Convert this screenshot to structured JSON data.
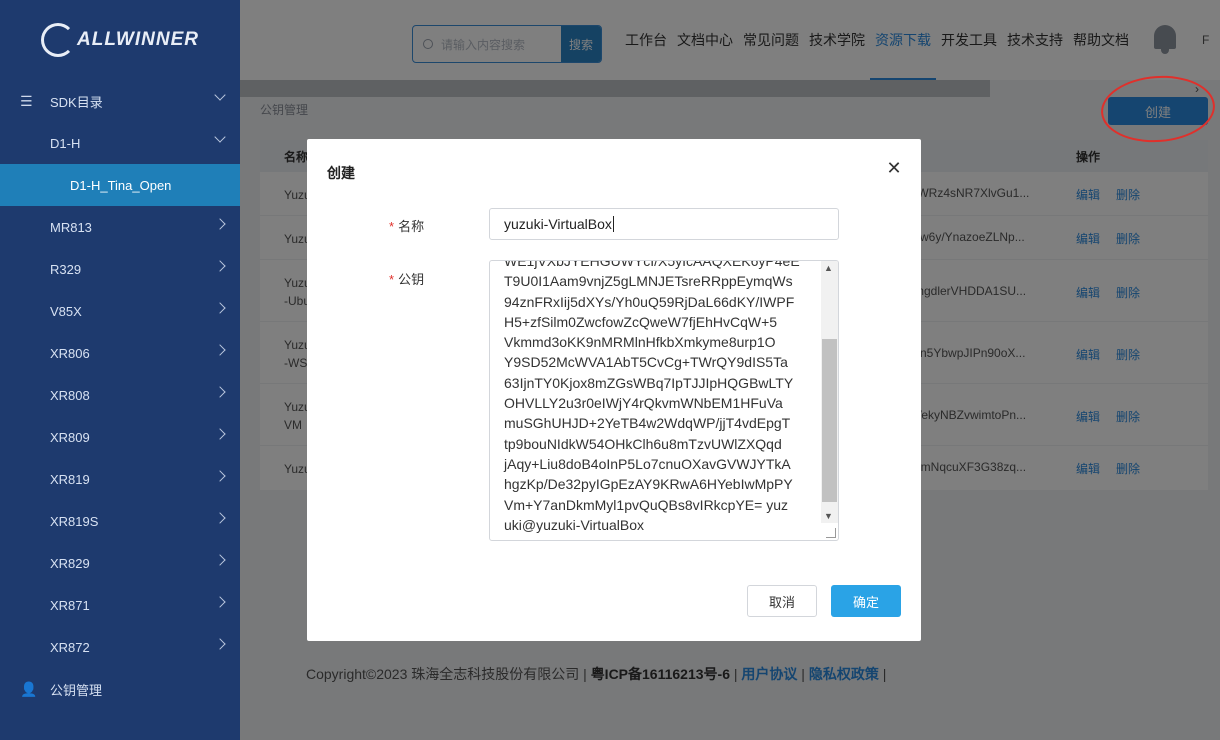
{
  "brand": {
    "logo_text": "ALLWINNER"
  },
  "sidebar": {
    "items": [
      {
        "label": "SDK目录",
        "icon": "list-icon"
      },
      {
        "label": "D1-H"
      },
      {
        "label": "D1-H_Tina_Open"
      },
      {
        "label": "MR813"
      },
      {
        "label": "R329"
      },
      {
        "label": "V85X"
      },
      {
        "label": "XR806"
      },
      {
        "label": "XR808"
      },
      {
        "label": "XR809"
      },
      {
        "label": "XR819"
      },
      {
        "label": "XR819S"
      },
      {
        "label": "XR829"
      },
      {
        "label": "XR871"
      },
      {
        "label": "XR872"
      },
      {
        "label": "公钥管理",
        "icon": "user-key-icon"
      }
    ]
  },
  "header": {
    "search": {
      "placeholder": "请输入内容搜索",
      "button": "搜索"
    },
    "nav": [
      "工作台",
      "文档中心",
      "常见问题",
      "技术学院",
      "资源下载",
      "开发工具",
      "技术支持",
      "帮助文档"
    ],
    "active_nav": "资源下载",
    "tail": "F"
  },
  "page": {
    "breadcrumb": "公钥管理",
    "create_button": "创建",
    "table": {
      "col_name": "名称",
      "col_op": "操作",
      "rows": [
        {
          "name": "Yuzu",
          "key_tail": "/WRz4sNR7XlvGu1...",
          "edit": "编辑",
          "delete": "删除"
        },
        {
          "name": "Yuzu",
          "key_tail": "yw6y/YnazoeZLNp...",
          "edit": "编辑",
          "delete": "删除"
        },
        {
          "name": "Yuzu -Ubu",
          "key_tail": "mgdlerVHDDA1SU...",
          "edit": "编辑",
          "delete": "删除"
        },
        {
          "name": "Yuzu -WSL",
          "key_tail": "xn5YbwpJIPn90oX...",
          "edit": "编辑",
          "delete": "删除"
        },
        {
          "name": "Yuzu VM",
          "key_tail": "VekyNBZvwimtoPn...",
          "edit": "编辑",
          "delete": "删除"
        },
        {
          "name": "Yuzu",
          "key_tail": "nmNqcuXF3G38zq...",
          "edit": "编辑",
          "delete": "删除"
        }
      ]
    },
    "footer": {
      "copyright": "Copyright©2023 珠海全志科技股份有限公司 | ",
      "icp": "粤ICP备16116213号-6",
      "sep1": " | ",
      "user_agreement": "用户协议",
      "sep2": " | ",
      "privacy": "隐私权政策",
      "sep3": " |"
    }
  },
  "modal": {
    "title": "创建",
    "name_label": "名称",
    "name_value": "yuzuki-VirtualBox",
    "key_label": "公钥",
    "key_value": "WE1jVXbJYEHGUWYcI/X5yIcAAQXEK6yP4eE\nT9U0I1Aam9vnjZ5gLMNJETsreRRppEymqWs\n94znFRxIij5dXYs/Yh0uQ59RjDaL66dKY/IWPF\nH5+zfSilm0ZwcfowZcQweW7fjEhHvCqW+5\nVkmmd3oKK9nMRMlnHfkbXmkyme8urp1O\nY9SD52McWVA1AbT5CvCg+TWrQY9dIS5Ta\n63IjnTY0Kjox8mZGsWBq7IpTJJIpHQGBwLTY\nOHVLLY2u3r0eIWjY4rQkvmWNbEM1HFuVa\nmuSGhUHJD+2YeTB4w2WdqWP/jjT4vdEpgT\ntp9bouNIdkW54OHkClh6u8mTzvUWlZXQqd\njAqy+Liu8doB4oInP5Lo7cnuOXavGVWJYTkA\nhgzKp/De32pyIGpEzAY9KRwA6HYebIwMpPY\nVm+Y7anDkmMyl1pvQuQBs8vIRkcpYE= yuz\nuki@yuzuki-VirtualBox",
    "cancel": "取消",
    "confirm": "确定"
  },
  "colors": {
    "sidebar": "#1e3a6e",
    "accent": "#2a8be0",
    "highlight": "#1f7fb8",
    "annotation": "#e0302b"
  }
}
